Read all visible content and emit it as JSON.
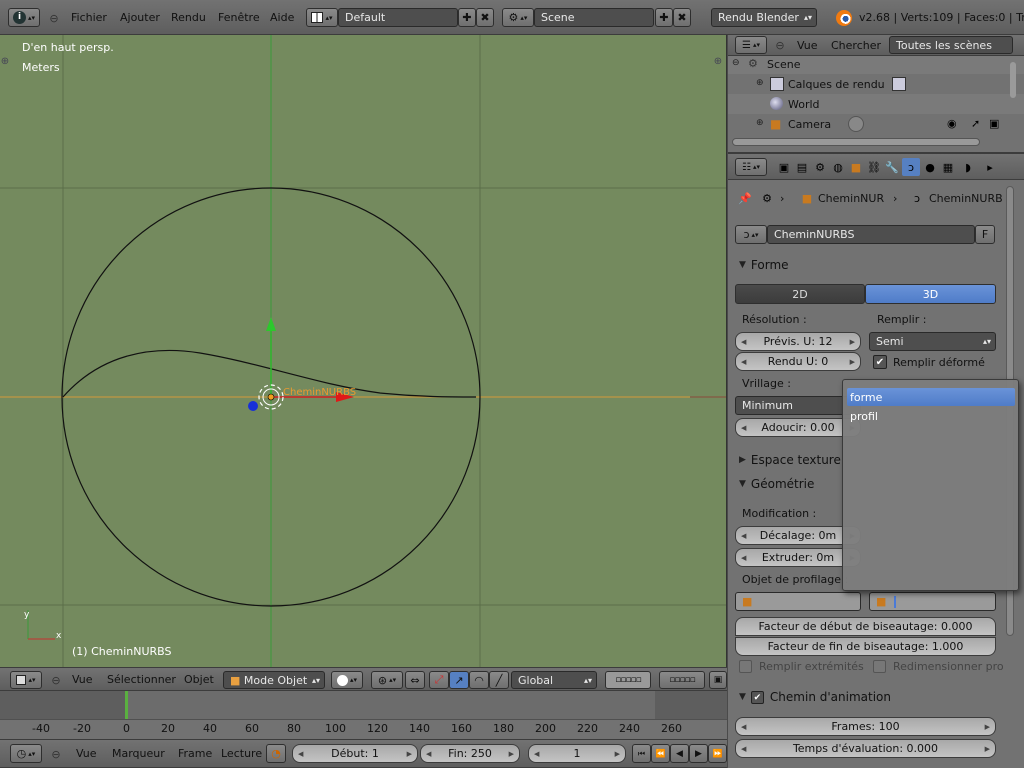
{
  "top_header": {
    "menus": [
      "Fichier",
      "Ajouter",
      "Rendu",
      "Fenêtre",
      "Aide"
    ],
    "layout_name": "Default",
    "scene_name": "Scene",
    "render_engine": "Rendu Blender",
    "stats": "v2.68 | Verts:109 | Faces:0 | Tri"
  },
  "viewport": {
    "view_label": "D'en haut persp.",
    "units_label": "Meters",
    "object_label": "(1) CheminNURBS",
    "object_name_overlay": "CheminNURBS",
    "background": "#748a5e",
    "header": {
      "menus": [
        "Vue",
        "Sélectionner",
        "Objet"
      ],
      "mode": "Mode Objet",
      "orientation": "Global"
    }
  },
  "outliner": {
    "menus": [
      "Vue",
      "Chercher"
    ],
    "filter": "Toutes les scènes",
    "items": [
      {
        "label": "Scene",
        "indent": 0
      },
      {
        "label": "Calques de rendu",
        "indent": 1
      },
      {
        "label": "World",
        "indent": 1
      },
      {
        "label": "Camera",
        "indent": 1
      }
    ]
  },
  "properties": {
    "breadcrumb": [
      "CheminNUR",
      "CheminNURB"
    ],
    "datablock_name": "CheminNURBS",
    "datablock_fake": "F",
    "panels": {
      "forme": "Forme",
      "espace_texture": "Espace texture",
      "geometrie": "Géométrie",
      "chemin_animation": "Chemin d'animation"
    },
    "dim_2d": "2D",
    "dim_3d": "3D",
    "resolution_label": "Résolution  :",
    "remplir_label": "Remplir  :",
    "previs_u": "Prévis. U: 12",
    "rendu_u": "Rendu U: 0",
    "remplir_value": "Semi",
    "remplir_deforme": "Remplir déformé",
    "vrillage_label": "Vrillage  :",
    "vrillage_value": "Minimum",
    "adoucir": "Adoucir: 0.00",
    "modification_label": "Modification  :",
    "decalage": "Décalage: 0m",
    "extruder": "Extruder: 0m",
    "profilage_label": "Objet de profilage  :",
    "bevel_start": "Facteur de début de biseautage: 0.000",
    "bevel_end": "Facteur de fin de biseautage: 1.000",
    "remplir_extremites": "Remplir extrémités",
    "redimensionner": "Redimensionner pro",
    "frames": "Frames: 100",
    "temps_evaluation": "Temps d'évaluation: 0.000"
  },
  "dropdown": {
    "items": [
      "forme",
      "profil"
    ],
    "selected": 0
  },
  "timeline": {
    "ticks": [
      "-40",
      "-20",
      "0",
      "20",
      "40",
      "60",
      "80",
      "100",
      "120",
      "140",
      "160",
      "180",
      "200",
      "220",
      "240",
      "260"
    ],
    "menus": [
      "Vue",
      "Marqueur",
      "Frame",
      "Lecture"
    ],
    "start": "Début: 1",
    "end": "Fin: 250",
    "current": "1"
  }
}
